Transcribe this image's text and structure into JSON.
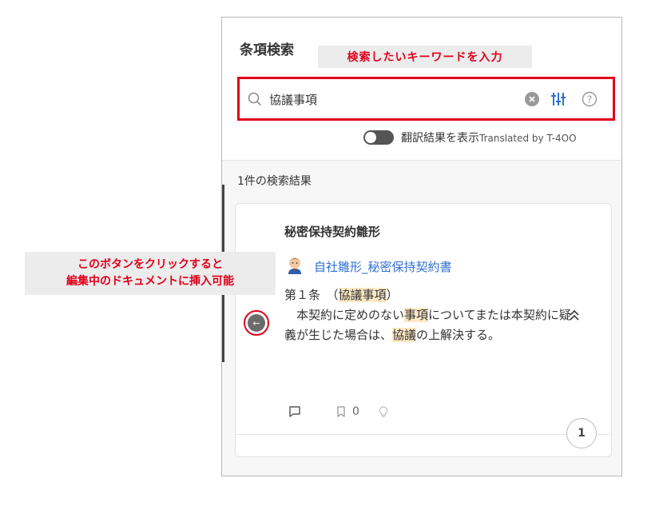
{
  "panel": {
    "title": "条項検索"
  },
  "annotations": {
    "top_callout": "検索したいキーワードを入力",
    "left_callout_line1": "このボタンをクリックすると",
    "left_callout_line2": "編集中のドキュメントに挿入可能"
  },
  "search": {
    "value": "協議事項",
    "icons": [
      "search-icon",
      "clear-icon",
      "filter-icon",
      "help-icon"
    ]
  },
  "translate_toggle": {
    "label": "翻訳結果を表示",
    "provider": "Translated by T-4OO",
    "enabled": false
  },
  "results": {
    "count_label": "1件の検索結果",
    "items": [
      {
        "title": "秘密保持契約雛形",
        "document": "自社雛形_秘密保持契約書",
        "clause_heading_prefix": "第１条　（",
        "clause_heading_kw1": "協議",
        "clause_heading_kw2": "事項",
        "clause_heading_suffix": "）",
        "body_part1": "　本契約に定めのない",
        "body_kw1": "事項",
        "body_part2": "についてまたは本契約に疑義が生じた場合は、",
        "body_kw2": "協議",
        "body_part3": "の上解決する。",
        "bookmark_count": "0",
        "page": "1"
      }
    ]
  },
  "colors": {
    "accent_red": "#e0001b",
    "link_blue": "#2f6fd6",
    "highlight": "#fde9c4"
  }
}
